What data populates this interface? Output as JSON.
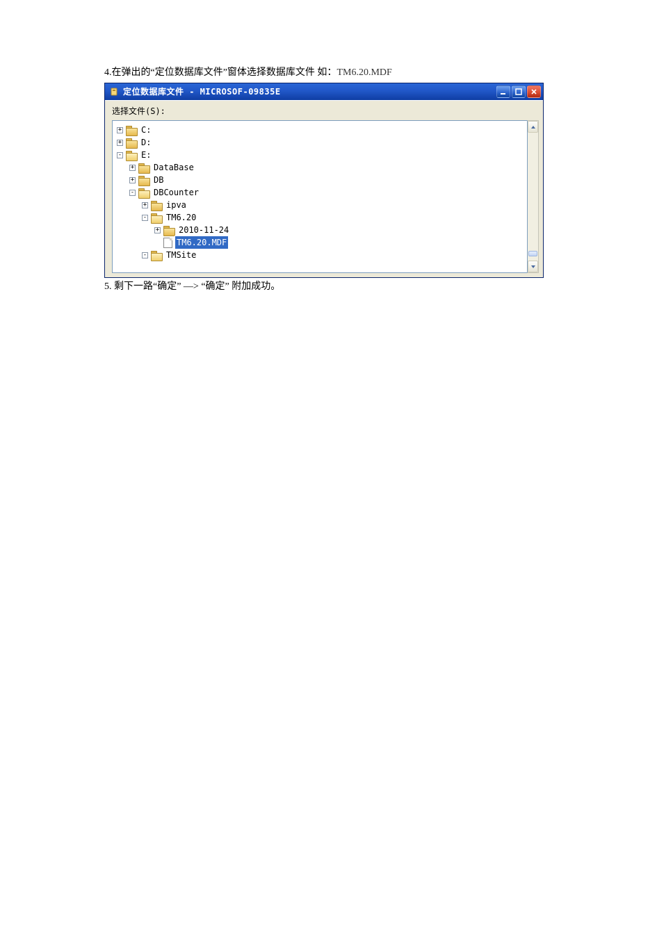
{
  "doc": {
    "step4_prefix": "4.",
    "step4_text": "在弹出的“定位数据库文件”窗体选择数据库文件  如：",
    "step4_example": "TM6.20.MDF",
    "step5_prefix": "5.",
    "step5_text": " 剩下一路“确定”  —> “确定” 附加成功。"
  },
  "dialog": {
    "title": "定位数据库文件 - MICROSOF-09835E",
    "select_label": "选择文件(S):"
  },
  "tree": {
    "c_label": "C:",
    "d_label": "D:",
    "e_label": "E:",
    "database_label": "DataBase",
    "db_label": "DB",
    "dbcounter_label": "DBCounter",
    "ipva_label": "ipva",
    "tm620_label": "TM6.20",
    "date_label": "2010-11-24",
    "mdf_label": "TM6.20.MDF",
    "tmsite_label": "TMSite"
  },
  "expander": {
    "plus": "+",
    "minus": "-"
  }
}
